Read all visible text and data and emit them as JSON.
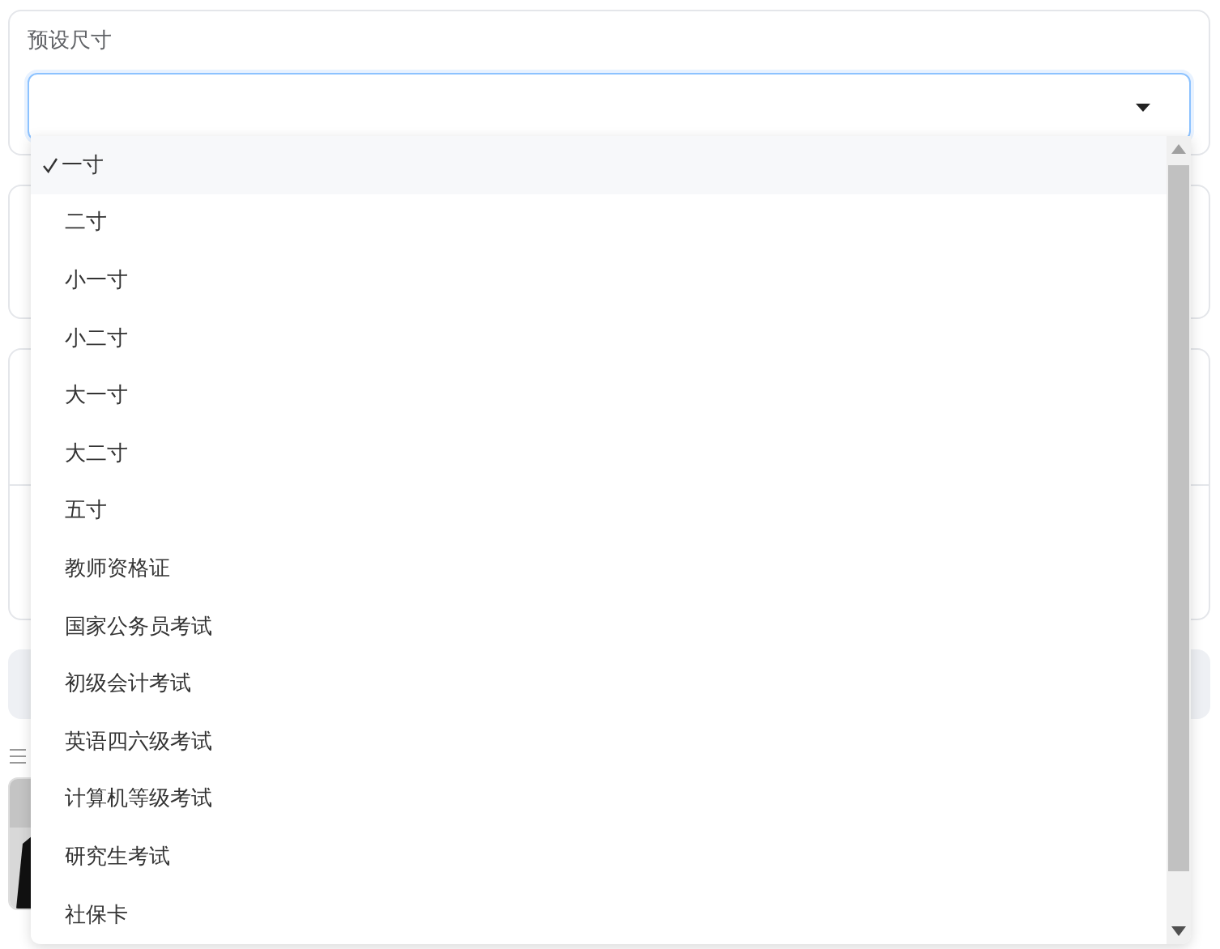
{
  "preset_size": {
    "label": "预设尺寸",
    "expanded": true,
    "options": [
      {
        "label": "一寸",
        "selected": true
      },
      {
        "label": "二寸",
        "selected": false
      },
      {
        "label": "小一寸",
        "selected": false
      },
      {
        "label": "小二寸",
        "selected": false
      },
      {
        "label": "大一寸",
        "selected": false
      },
      {
        "label": "大二寸",
        "selected": false
      },
      {
        "label": "五寸",
        "selected": false
      },
      {
        "label": "教师资格证",
        "selected": false
      },
      {
        "label": "国家公务员考试",
        "selected": false
      },
      {
        "label": "初级会计考试",
        "selected": false
      },
      {
        "label": "英语四六级考试",
        "selected": false
      },
      {
        "label": "计算机等级考试",
        "selected": false
      },
      {
        "label": "研究生考试",
        "selected": false
      },
      {
        "label": "社保卡",
        "selected": false
      }
    ]
  }
}
